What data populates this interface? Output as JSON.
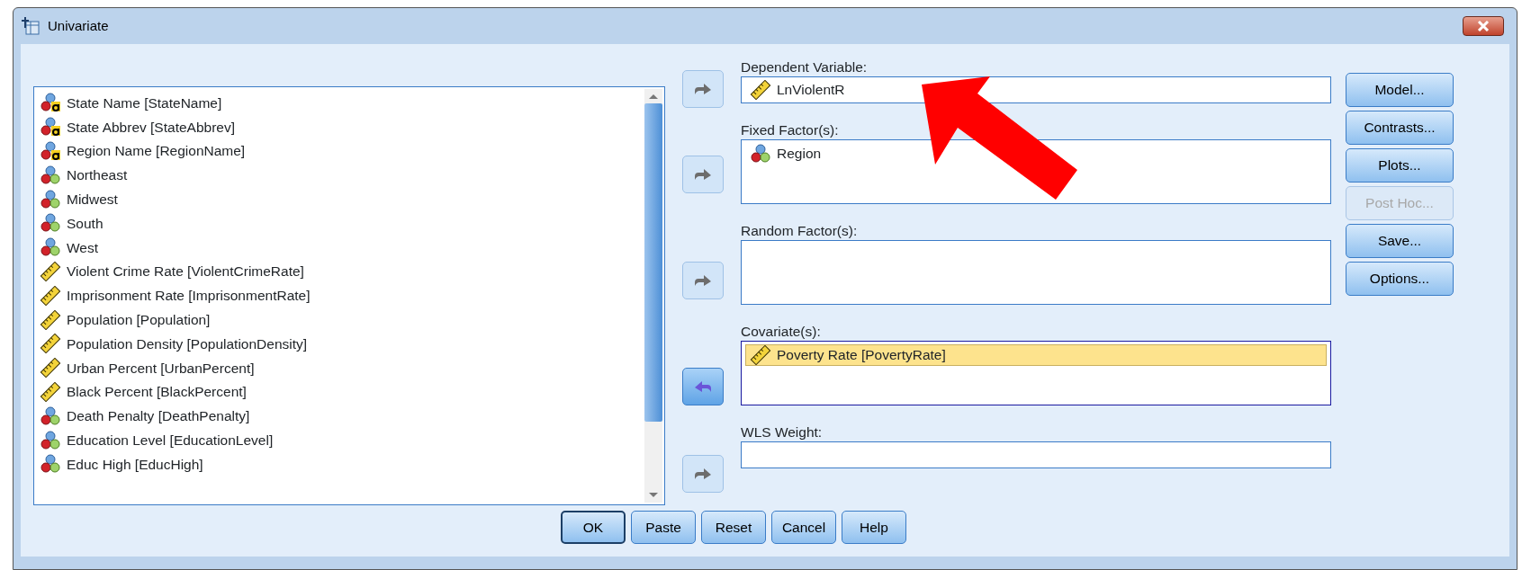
{
  "window": {
    "title": "Univariate"
  },
  "variables": [
    {
      "label": "State Name [StateName]",
      "kind": "string"
    },
    {
      "label": "State Abbrev [StateAbbrev]",
      "kind": "string"
    },
    {
      "label": "Region Name [RegionName]",
      "kind": "string"
    },
    {
      "label": "Northeast",
      "kind": "nominal"
    },
    {
      "label": "Midwest",
      "kind": "nominal"
    },
    {
      "label": "South",
      "kind": "nominal"
    },
    {
      "label": "West",
      "kind": "nominal"
    },
    {
      "label": "Violent Crime Rate [ViolentCrimeRate]",
      "kind": "scale"
    },
    {
      "label": "Imprisonment Rate [ImprisonmentRate]",
      "kind": "scale"
    },
    {
      "label": "Population  [Population]",
      "kind": "scale"
    },
    {
      "label": "Population Density [PopulationDensity]",
      "kind": "scale"
    },
    {
      "label": "Urban Percent [UrbanPercent]",
      "kind": "scale"
    },
    {
      "label": "Black Percent [BlackPercent]",
      "kind": "scale"
    },
    {
      "label": "Death Penalty [DeathPenalty]",
      "kind": "nominal"
    },
    {
      "label": "Education Level [EducationLevel]",
      "kind": "nominal"
    },
    {
      "label": "Educ High [EducHigh]",
      "kind": "nominal"
    }
  ],
  "targets": [
    {
      "label": "Dependent Variable:",
      "kind": "single",
      "remove": false,
      "items": [
        {
          "label": "LnViolentR",
          "kind": "scale",
          "selected": false
        }
      ]
    },
    {
      "label": "Fixed Factor(s):",
      "kind": "multi",
      "remove": false,
      "items": [
        {
          "label": "Region",
          "kind": "nominal",
          "selected": false
        }
      ]
    },
    {
      "label": "Random Factor(s):",
      "kind": "multi",
      "remove": false
    },
    {
      "label": "Covariate(s):",
      "kind": "multi",
      "remove": true,
      "items": [
        {
          "label": "Poverty Rate [PovertyRate]",
          "kind": "scale",
          "selected": true
        }
      ]
    },
    {
      "label": "WLS Weight:",
      "kind": "single",
      "remove": false
    }
  ],
  "side_buttons": [
    {
      "label": "Model...",
      "disabled": false
    },
    {
      "label": "Contrasts...",
      "disabled": false
    },
    {
      "label": "Plots...",
      "disabled": false
    },
    {
      "label": "Post Hoc...",
      "disabled": true
    },
    {
      "label": "Save...",
      "disabled": false
    },
    {
      "label": "Options...",
      "disabled": false
    }
  ],
  "bottom_buttons": [
    {
      "label": "OK",
      "default": true
    },
    {
      "label": "Paste",
      "default": false
    },
    {
      "label": "Reset",
      "default": false
    },
    {
      "label": "Cancel",
      "default": false
    },
    {
      "label": "Help",
      "default": false
    }
  ],
  "annotation": {
    "kind": "arrow"
  }
}
